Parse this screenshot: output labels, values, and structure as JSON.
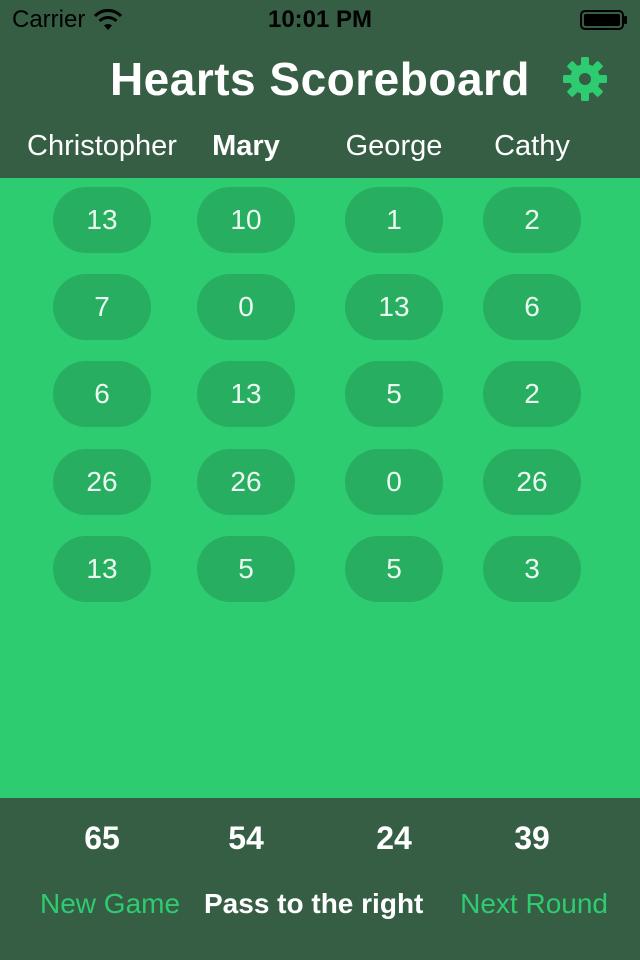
{
  "status_bar": {
    "carrier": "Carrier",
    "time": "10:01 PM"
  },
  "header": {
    "title": "Hearts Scoreboard",
    "settings_icon": "gear-icon"
  },
  "players": [
    {
      "name": "Christopher",
      "active": false
    },
    {
      "name": "Mary",
      "active": true
    },
    {
      "name": "George",
      "active": false
    },
    {
      "name": "Cathy",
      "active": false
    }
  ],
  "rounds": [
    [
      "13",
      "10",
      "1",
      "2"
    ],
    [
      "7",
      "0",
      "13",
      "6"
    ],
    [
      "6",
      "13",
      "5",
      "2"
    ],
    [
      "26",
      "26",
      "0",
      "26"
    ],
    [
      "13",
      "5",
      "5",
      "3"
    ]
  ],
  "totals": [
    "65",
    "54",
    "24",
    "39"
  ],
  "footer": {
    "new_game_label": "New Game",
    "pass_label": "Pass to the right",
    "next_round_label": "Next Round"
  },
  "colors": {
    "header_bg": "#355e44",
    "body_bg": "#2ecc71",
    "pill_bg": "#27ae60",
    "accent": "#2ecc71"
  }
}
